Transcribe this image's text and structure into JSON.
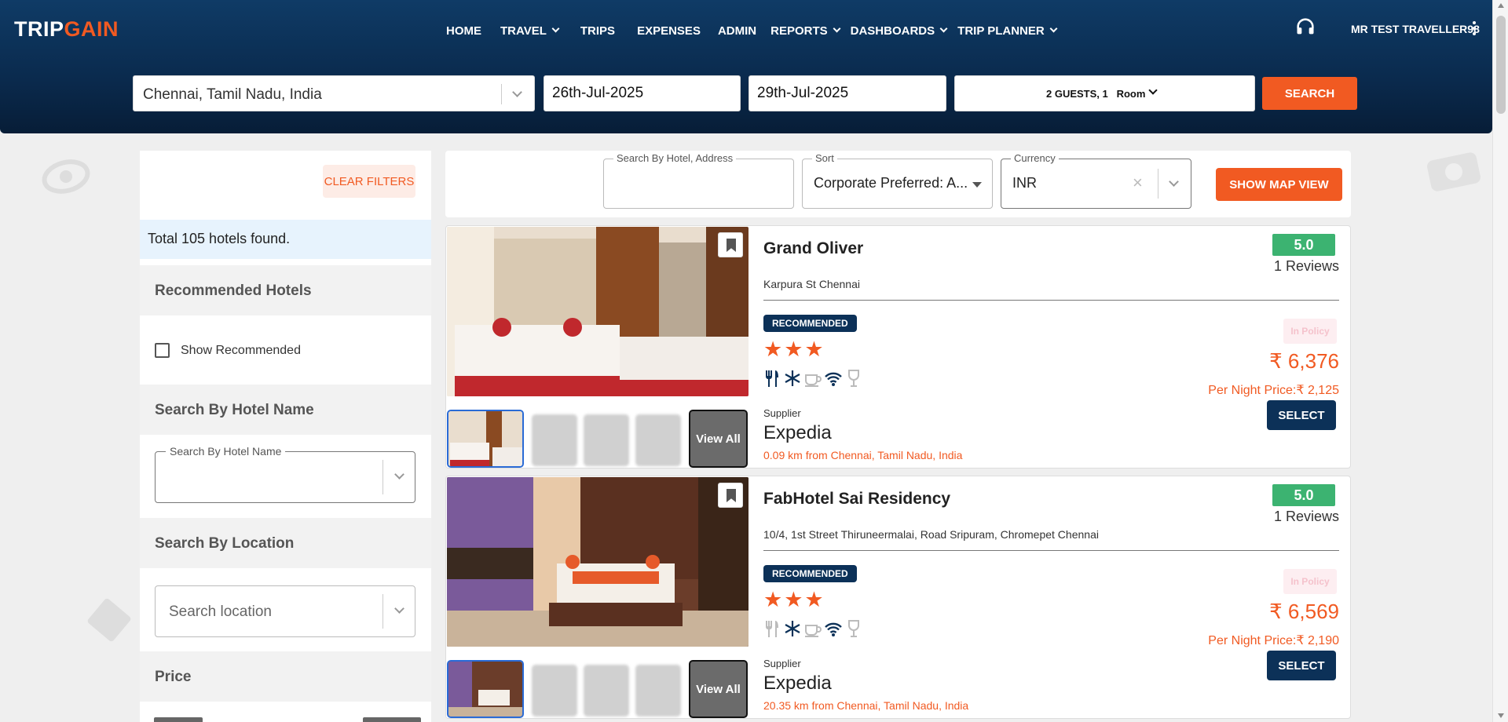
{
  "app": {
    "logo_prefix": "TRIP",
    "logo_suffix": "GAIN",
    "nav": [
      {
        "label": "HOME",
        "dropdown": false
      },
      {
        "label": "TRAVEL",
        "dropdown": true
      },
      {
        "label": "TRIPS",
        "dropdown": false
      },
      {
        "label": "EXPENSES",
        "dropdown": false
      },
      {
        "label": "ADMIN",
        "dropdown": false
      },
      {
        "label": "REPORTS",
        "dropdown": true
      },
      {
        "label": "DASHBOARDS",
        "dropdown": true
      },
      {
        "label": "TRIP PLANNER",
        "dropdown": true
      }
    ],
    "user_name": "MR TEST TRAVELLER98",
    "support_icon": "headset-icon",
    "accent_color": "#f15a22",
    "navy_color": "#0c3158"
  },
  "search": {
    "city": "Chennai, Tamil Nadu, India",
    "checkin": "26th-Jul-2025",
    "checkout": "29th-Jul-2025",
    "guests": "2 GUESTS, 1",
    "room": "Room",
    "search_label": "SEARCH"
  },
  "filters": {
    "clear_label": "CLEAR FILTERS",
    "total": "Total 105 hotels found.",
    "recommended_title": "Recommended Hotels",
    "show_recommended": "Show Recommended",
    "hotel_name_title": "Search By Hotel Name",
    "hotel_name_label": "Search By Hotel Name",
    "location_title": "Search By Location",
    "location_placeholder": "Search location",
    "price_title": "Price"
  },
  "toolbar": {
    "search_label": "Search By Hotel, Address",
    "sort_label": "Sort",
    "sort_value": "Corporate Preferred: A...",
    "currency_label": "Currency",
    "currency_value": "INR",
    "map_label": "SHOW MAP VIEW"
  },
  "hotels": [
    {
      "name": "Grand Oliver",
      "address": "Karpura St Chennai",
      "rating": "5.0",
      "reviews": "1 Reviews",
      "badge": "RECOMMENDED",
      "stars": "★★★",
      "policy": "In Policy",
      "price": "₹ 6,376",
      "per_night": "Per Night Price:₹ 2,125",
      "select_label": "SELECT",
      "supplier_label": "Supplier",
      "supplier": "Expedia",
      "distance": "0.09 km from Chennai, Tamil Nadu, India",
      "view_all": "View All",
      "amenities": [
        "restaurant-icon",
        "ac-icon",
        "coffee-icon",
        "wifi-icon",
        "bar-icon"
      ]
    },
    {
      "name": "FabHotel Sai Residency",
      "address": "10/4, 1st Street Thiruneermalai, Road Sripuram, Chromepet Chennai",
      "rating": "5.0",
      "reviews": "1 Reviews",
      "badge": "RECOMMENDED",
      "stars": "★★★",
      "policy": "In Policy",
      "price": "₹ 6,569",
      "per_night": "Per Night Price:₹ 2,190",
      "select_label": "SELECT",
      "supplier_label": "Supplier",
      "supplier": "Expedia",
      "distance": "20.35 km from Chennai, Tamil Nadu, India",
      "view_all": "View All",
      "amenities": [
        "restaurant-icon",
        "ac-icon",
        "coffee-icon",
        "wifi-icon",
        "bar-icon"
      ]
    }
  ]
}
